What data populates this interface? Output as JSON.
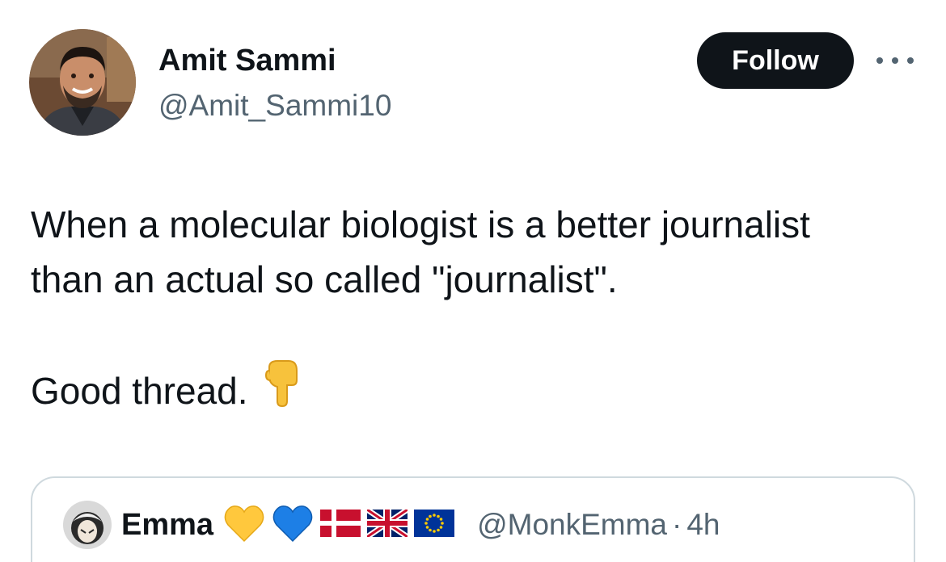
{
  "author": {
    "display_name": "Amit Sammi",
    "handle": "@Amit_Sammi10"
  },
  "actions": {
    "follow_label": "Follow",
    "more_icon": "more-dots-icon"
  },
  "tweet": {
    "line1": "When a molecular biologist is a better journalist",
    "line2": "than an actual so called \"journalist\".",
    "line3": "Good thread.",
    "emoji": "backhand-index-pointing-down-icon"
  },
  "quoted": {
    "display_name": "Emma",
    "badges": [
      "yellow-heart-icon",
      "blue-heart-icon",
      "denmark-flag-icon",
      "uk-flag-icon",
      "eu-flag-icon"
    ],
    "handle": "@MonkEmma",
    "separator": "·",
    "time": "4h"
  },
  "colors": {
    "text": "#0f1419",
    "secondary": "#536471",
    "button_bg": "#0f1419",
    "border": "#cfd9de"
  }
}
